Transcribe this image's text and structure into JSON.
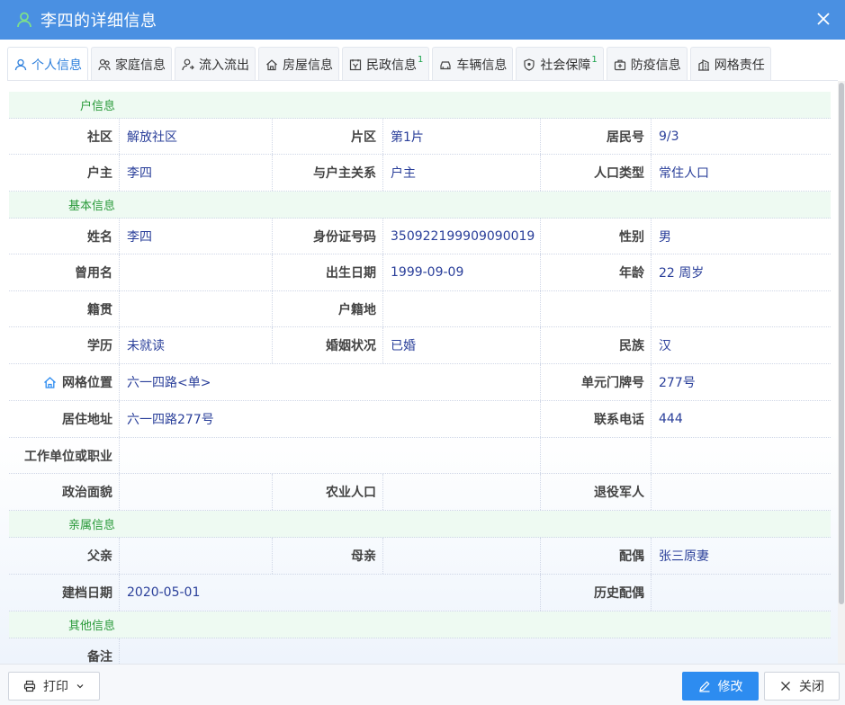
{
  "window": {
    "title": "李四的详细信息"
  },
  "tabs": [
    {
      "label": "个人信息",
      "icon": "user-icon",
      "badge": ""
    },
    {
      "label": "家庭信息",
      "icon": "family-icon",
      "badge": ""
    },
    {
      "label": "流入流出",
      "icon": "flow-icon",
      "badge": ""
    },
    {
      "label": "房屋信息",
      "icon": "house-icon",
      "badge": ""
    },
    {
      "label": "民政信息",
      "icon": "civil-icon",
      "badge": "1"
    },
    {
      "label": "车辆信息",
      "icon": "car-icon",
      "badge": ""
    },
    {
      "label": "社会保障",
      "icon": "shield-icon",
      "badge": "1"
    },
    {
      "label": "防疫信息",
      "icon": "medkit-icon",
      "badge": ""
    },
    {
      "label": "网格责任",
      "icon": "building-icon",
      "badge": ""
    }
  ],
  "sections": {
    "household": "户信息",
    "basic": "基本信息",
    "relatives": "亲属信息",
    "other": "其他信息"
  },
  "fields": {
    "community": {
      "label": "社区",
      "value": "解放社区"
    },
    "district": {
      "label": "片区",
      "value": "第1片"
    },
    "resident_no": {
      "label": "居民号",
      "value": "9/3"
    },
    "head": {
      "label": "户主",
      "value": "李四"
    },
    "relation": {
      "label": "与户主关系",
      "value": "户主"
    },
    "pop_type": {
      "label": "人口类型",
      "value": "常住人口"
    },
    "name": {
      "label": "姓名",
      "value": "李四"
    },
    "id_no": {
      "label": "身份证号码",
      "value": "350922199909090019"
    },
    "gender": {
      "label": "性别",
      "value": "男"
    },
    "former_name": {
      "label": "曾用名",
      "value": ""
    },
    "birth": {
      "label": "出生日期",
      "value": "1999-09-09"
    },
    "age": {
      "label": "年龄",
      "value": "22 周岁"
    },
    "native": {
      "label": "籍贯",
      "value": ""
    },
    "hukou": {
      "label": "户籍地",
      "value": ""
    },
    "education": {
      "label": "学历",
      "value": "未就读"
    },
    "marriage": {
      "label": "婚姻状况",
      "value": "已婚"
    },
    "ethnic": {
      "label": "民族",
      "value": "汉"
    },
    "grid_loc": {
      "label": "网格位置",
      "value": "六一四路<单>"
    },
    "unit_no": {
      "label": "单元门牌号",
      "value": "277号"
    },
    "address": {
      "label": "居住地址",
      "value": "六一四路277号"
    },
    "phone": {
      "label": "联系电话",
      "value": "444"
    },
    "work": {
      "label": "工作单位或职业",
      "value": ""
    },
    "political": {
      "label": "政治面貌",
      "value": ""
    },
    "agri": {
      "label": "农业人口",
      "value": ""
    },
    "veteran": {
      "label": "退役军人",
      "value": ""
    },
    "father": {
      "label": "父亲",
      "value": ""
    },
    "mother": {
      "label": "母亲",
      "value": ""
    },
    "spouse": {
      "label": "配偶",
      "value": "张三原妻"
    },
    "file_date": {
      "label": "建档日期",
      "value": "2020-05-01"
    },
    "hist_spouse": {
      "label": "历史配偶",
      "value": ""
    },
    "remark": {
      "label": "备注",
      "value": ""
    }
  },
  "footer": {
    "print_label": "打印",
    "edit_label": "修改",
    "close_label": "关闭"
  },
  "colors": {
    "titlebar": "#4a90e2",
    "primary_button": "#2d8cf0",
    "section_text": "#2a9a3a",
    "value_text": "#2a3f9a"
  }
}
